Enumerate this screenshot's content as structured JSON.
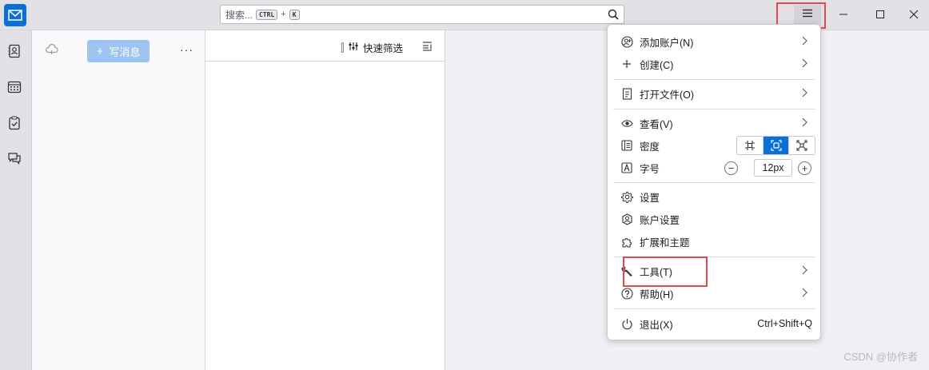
{
  "search": {
    "placeholder": "搜索...",
    "key_ctrl": "CTRL",
    "key_plus": "+",
    "key_k": "K"
  },
  "folder_pane": {
    "write_label": "写消息",
    "more_label": "···"
  },
  "thread_pane": {
    "quick_filter_label": "快速筛选"
  },
  "app_menu": {
    "add_account": "添加账户(N)",
    "create": "创建(C)",
    "open_file": "打开文件(O)",
    "view": "查看(V)",
    "density": "密度",
    "font_size": "字号",
    "font_size_value": "12px",
    "settings": "设置",
    "account_settings": "账户设置",
    "addons_themes": "扩展和主题",
    "tools": "工具(T)",
    "help": "帮助(H)",
    "quit": "退出(X)",
    "quit_shortcut": "Ctrl+Shift+Q"
  },
  "watermark": "CSDN @协作者",
  "colors": {
    "accent": "#0a6fd6",
    "highlight": "#e24b4b",
    "write_button": "#9cc4f3"
  }
}
